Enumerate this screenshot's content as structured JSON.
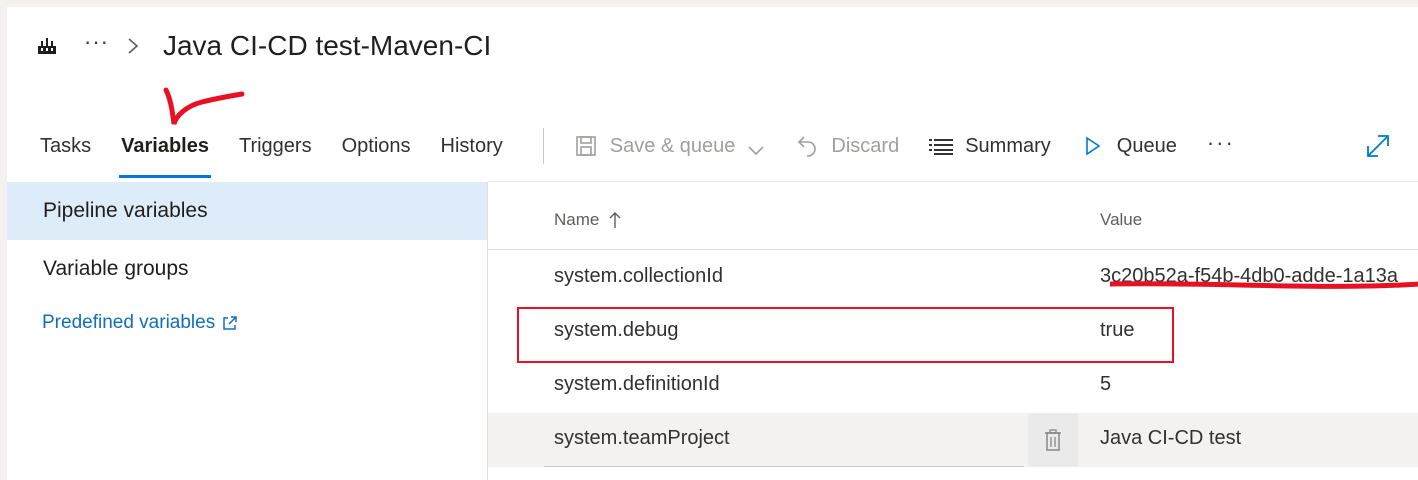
{
  "header": {
    "icon": "pipeline-icon",
    "more_label": "···",
    "title": "Java CI-CD test-Maven-CI"
  },
  "tabs": [
    {
      "label": "Tasks",
      "active": false
    },
    {
      "label": "Variables",
      "active": true
    },
    {
      "label": "Triggers",
      "active": false
    },
    {
      "label": "Options",
      "active": false
    },
    {
      "label": "History",
      "active": false
    }
  ],
  "toolbar": {
    "save_queue_label": "Save & queue",
    "discard_label": "Discard",
    "summary_label": "Summary",
    "queue_label": "Queue",
    "more_label": "···"
  },
  "leftnav": {
    "pipeline_variables": "Pipeline variables",
    "variable_groups": "Variable groups",
    "predefined_variables": "Predefined variables"
  },
  "grid": {
    "name_header": "Name",
    "value_header": "Value",
    "rows": [
      {
        "name": "system.collectionId",
        "value": "3c20b52a-f54b-4db0-adde-1a13a"
      },
      {
        "name": "system.debug",
        "value": "true"
      },
      {
        "name": "system.definitionId",
        "value": "5"
      },
      {
        "name": "system.teamProject",
        "value": "Java CI-CD test"
      }
    ]
  },
  "colors": {
    "accent": "#0078d4",
    "link": "#106ebe",
    "annotation_red": "#e81123",
    "selected_bg": "#deecf9"
  }
}
